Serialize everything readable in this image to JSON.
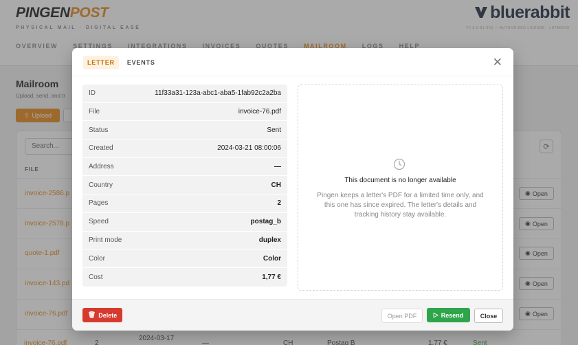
{
  "brand": {
    "name_dark": "PINGEN",
    "name_accent": "POST",
    "tagline": "PHYSICAL MAIL · DIGITAL EASE",
    "partner": "bluerabbit",
    "version": "V7.8.0-91-003 — AUTHORIZED LICENSE · LSTAGING"
  },
  "nav": [
    "OVERVIEW",
    "SETTINGS",
    "INTEGRATIONS",
    "INVOICES",
    "QUOTES",
    "MAILROOM",
    "LOGS",
    "HELP"
  ],
  "nav_active": "MAILROOM",
  "page": {
    "title": "Mailroom",
    "subtitle": "Upload, send, and tr",
    "upload_label": "Upload"
  },
  "table": {
    "search_placeholder": "Search...",
    "file_header": "FILE",
    "rows": [
      "invoice-2586.p",
      "invoice-2578.p",
      "quote-1.pdf",
      "invoice-143.pd",
      "invoice-76.pdf"
    ],
    "open_label": "Open",
    "last_row": {
      "file": "invoice-76.pdf",
      "pages": "2",
      "date": "2024-03-17",
      "address": "—",
      "country": "CH",
      "speed": "Postag B",
      "cost": "1,77 €",
      "status": "Sent"
    }
  },
  "modal": {
    "tabs": [
      "LETTER",
      "EVENTS"
    ],
    "active_tab": "LETTER",
    "details": [
      {
        "label": "ID",
        "value": "11f33a31-123a-abc1-aba5-1fab92c2a2ba"
      },
      {
        "label": "File",
        "value": "invoice-76.pdf"
      },
      {
        "label": "Status",
        "value": "Sent"
      },
      {
        "label": "Created",
        "value": "2024-03-21 08:00:06"
      },
      {
        "label": "Address",
        "value": "—"
      },
      {
        "label": "Country",
        "value": "CH"
      },
      {
        "label": "Pages",
        "value": "2"
      },
      {
        "label": "Speed",
        "value": "postag_b"
      },
      {
        "label": "Print mode",
        "value": "duplex"
      },
      {
        "label": "Color",
        "value": "Color"
      },
      {
        "label": "Cost",
        "value": "1,77 €"
      }
    ],
    "preview": {
      "title": "This document is no longer available",
      "text": "Pingen keeps a letter's PDF for a limited time only, and this one has since expired. The letter's details and tracking history stay available."
    },
    "buttons": {
      "delete": "Delete",
      "open_pdf": "Open PDF",
      "resend": "Resend",
      "close": "Close"
    }
  },
  "colors": {
    "accent": "#e8891b",
    "danger": "#d63a2e",
    "success": "#2ea54a"
  }
}
